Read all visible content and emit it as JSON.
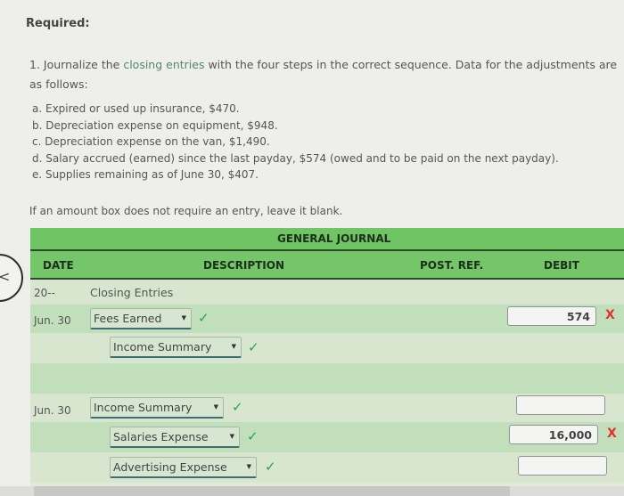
{
  "required_label": "Required:",
  "instruction": {
    "prefix": "1. Journalize the ",
    "link": "closing entries",
    "suffix": " with the four steps in the correct sequence. Data for the adjustments are as follows:"
  },
  "adjustments": [
    "a. Expired or used up insurance, $470.",
    "b. Depreciation expense on equipment, $948.",
    "c. Depreciation expense on the van, $1,490.",
    "d. Salary accrued (earned) since the last payday, $574 (owed and to be paid on the next payday).",
    "e. Supplies remaining as of June 30, $407."
  ],
  "note": "If an amount box does not require an entry, leave it blank.",
  "journal": {
    "title": "GENERAL JOURNAL",
    "columns": {
      "date": "DATE",
      "description": "DESCRIPTION",
      "post_ref": "POST. REF.",
      "debit": "DEBIT"
    },
    "year_row": {
      "date": "20--",
      "description": "Closing Entries"
    },
    "rows": [
      {
        "date": "Jun. 30",
        "account": "Fees Earned",
        "status": "correct",
        "debit": "574",
        "debit_status": "incorrect"
      },
      {
        "date": "",
        "account": "Income Summary",
        "status": "correct",
        "debit": "",
        "debit_status": ""
      },
      {
        "date": "",
        "account": "",
        "status": "",
        "debit": "",
        "debit_status": ""
      },
      {
        "date": "Jun. 30",
        "account": "Income Summary",
        "status": "correct",
        "debit": "",
        "debit_status": ""
      },
      {
        "date": "",
        "account": "Salaries Expense",
        "status": "correct",
        "debit": "16,000",
        "debit_status": "incorrect"
      },
      {
        "date": "",
        "account": "Advertising Expense",
        "status": "correct",
        "debit": "",
        "debit_status": ""
      }
    ]
  },
  "icons": {
    "correct": "✓",
    "incorrect": "X",
    "dropdown": "▼",
    "back": "<"
  }
}
